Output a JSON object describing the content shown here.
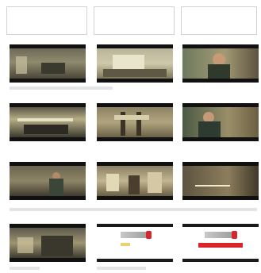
{
  "header_boxes": [
    {
      "text": ""
    },
    {
      "text": ""
    },
    {
      "text": ""
    }
  ],
  "rows": [
    {
      "caption": "",
      "frames": [
        {
          "scene": "room"
        },
        {
          "scene": "desk"
        },
        {
          "scene": "man"
        }
      ]
    },
    {
      "caption": "",
      "frames": [
        {
          "scene": "corridor"
        },
        {
          "scene": "shelves"
        },
        {
          "scene": "woman"
        }
      ]
    },
    {
      "caption": "",
      "frames": [
        {
          "scene": "office"
        },
        {
          "scene": "studio"
        },
        {
          "scene": "title-card"
        }
      ]
    },
    {
      "caption": "",
      "frames": [
        {
          "scene": "crowd"
        },
        {
          "scene": "logo"
        },
        {
          "scene": "logo-banner"
        }
      ]
    }
  ],
  "colors": {
    "letterbox": "#111111",
    "logo_red": "#d8262b"
  }
}
